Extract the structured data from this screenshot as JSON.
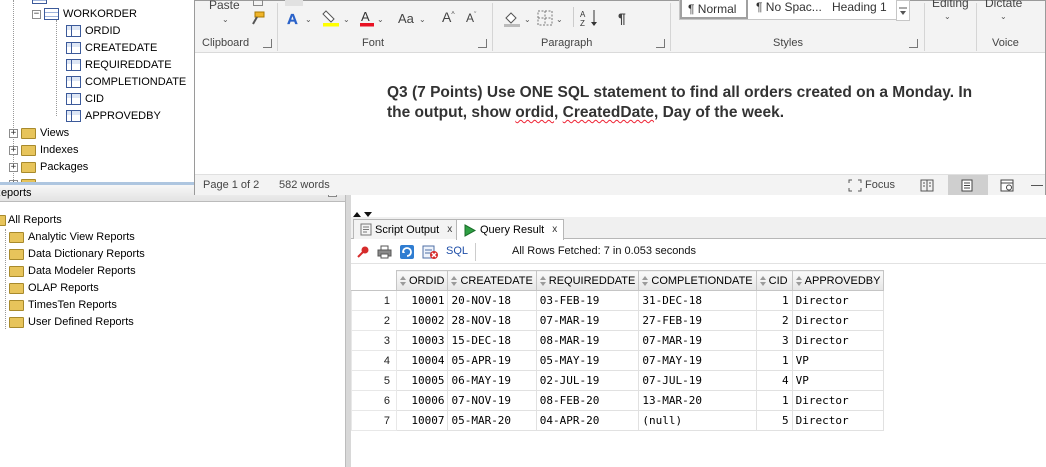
{
  "tree": {
    "table_name": "WORKORDER",
    "columns": [
      "ORDID",
      "CREATEDATE",
      "REQUIREDDATE",
      "COMPLETIONDATE",
      "CID",
      "APPROVEDBY"
    ],
    "folders": [
      "Views",
      "Indexes",
      "Packages"
    ]
  },
  "ribbon": {
    "paste_label": "Paste",
    "groups": {
      "clipboard": "Clipboard",
      "font": "Font",
      "paragraph": "Paragraph",
      "styles": "Styles",
      "voice": "Voice"
    },
    "font_aa": "Aa",
    "styles": [
      "¶ Normal",
      "¶ No Spac...",
      "Heading 1"
    ],
    "editing_label": "Editing",
    "dictate_label": "Dictate"
  },
  "document": {
    "question_line1": "Q3 (7 Points) Use ONE SQL statement to find all orders created on a Monday. In",
    "question_line2_pre": "the output, show ",
    "question_ordid": "ordid",
    "question_sep": ", ",
    "question_createddate": "CreatedDate",
    "question_line2_post": ", Day of the week."
  },
  "statusbar": {
    "page": "Page 1 of 2",
    "words": "582 words",
    "focus": "Focus"
  },
  "reports": {
    "header": "Reports",
    "items": [
      "All Reports",
      "Analytic View Reports",
      "Data Dictionary Reports",
      "Data Modeler Reports",
      "OLAP Reports",
      "TimesTen Reports",
      "User Defined Reports"
    ]
  },
  "results": {
    "tabs": [
      {
        "label": "Script Output"
      },
      {
        "label": "Query Result"
      }
    ],
    "sql_label": "SQL",
    "fetch_status": "All Rows Fetched: 7 in 0.053 seconds",
    "columns": [
      "ORDID",
      "CREATEDATE",
      "REQUIREDDATE",
      "COMPLETIONDATE",
      "CID",
      "APPROVEDBY"
    ],
    "rows": [
      {
        "n": "1",
        "ordid": "10001",
        "created": "20-NOV-18",
        "required": "03-FEB-19",
        "completion": "31-DEC-18",
        "cid": "1",
        "approvedby": "Director"
      },
      {
        "n": "2",
        "ordid": "10002",
        "created": "28-NOV-18",
        "required": "07-MAR-19",
        "completion": "27-FEB-19",
        "cid": "2",
        "approvedby": "Director"
      },
      {
        "n": "3",
        "ordid": "10003",
        "created": "15-DEC-18",
        "required": "08-MAR-19",
        "completion": "07-MAR-19",
        "cid": "3",
        "approvedby": "Director"
      },
      {
        "n": "4",
        "ordid": "10004",
        "created": "05-APR-19",
        "required": "05-MAY-19",
        "completion": "07-MAY-19",
        "cid": "1",
        "approvedby": "VP"
      },
      {
        "n": "5",
        "ordid": "10005",
        "created": "06-MAY-19",
        "required": "02-JUL-19",
        "completion": "07-JUL-19",
        "cid": "4",
        "approvedby": "VP"
      },
      {
        "n": "6",
        "ordid": "10006",
        "created": "07-NOV-19",
        "required": "08-FEB-20",
        "completion": "13-MAR-20",
        "cid": "1",
        "approvedby": "Director"
      },
      {
        "n": "7",
        "ordid": "10007",
        "created": "05-MAR-20",
        "required": "04-APR-20",
        "completion": "(null)",
        "cid": "5",
        "approvedby": "Director"
      }
    ]
  }
}
